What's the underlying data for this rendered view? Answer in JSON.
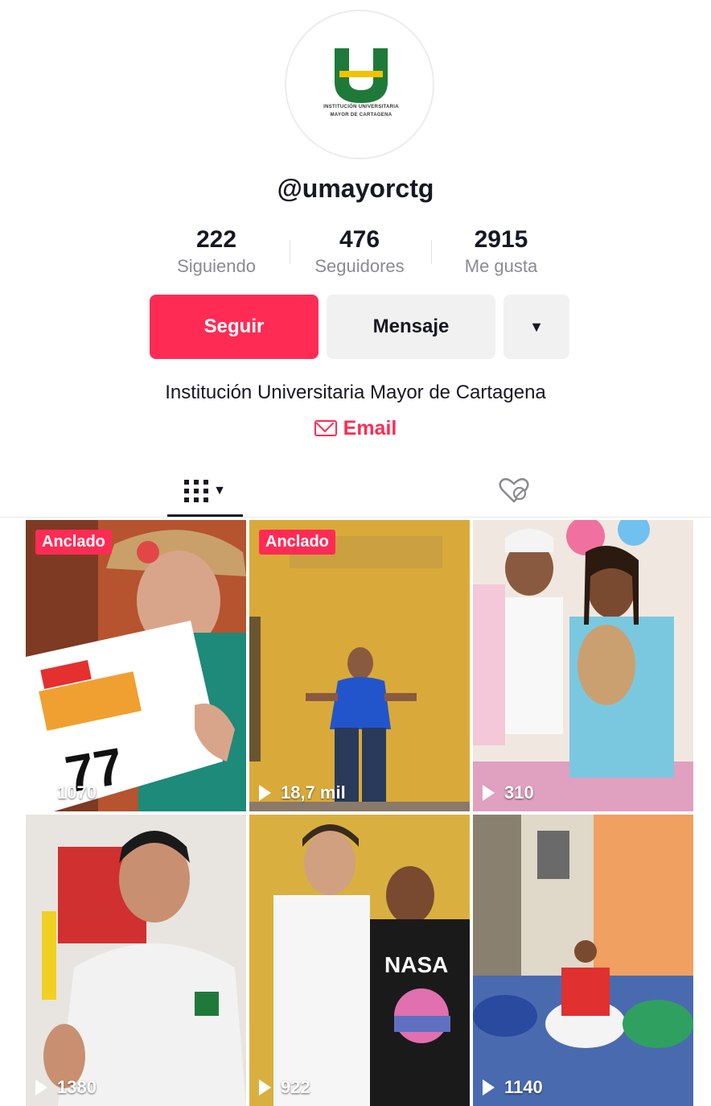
{
  "profile": {
    "logo_text_line1": "INSTITUCIÓN UNIVERSITARIA",
    "logo_text_line2": "MAYOR DE CARTAGENA",
    "handle": "@umayorctg",
    "bio": "Institución Universitaria Mayor de Cartagena",
    "email_label": "Email",
    "brand_color": "#fe2c55"
  },
  "stats": [
    {
      "value": "222",
      "label": "Siguiendo"
    },
    {
      "value": "476",
      "label": "Seguidores"
    },
    {
      "value": "2915",
      "label": "Me gusta"
    }
  ],
  "actions": {
    "follow_label": "Seguir",
    "message_label": "Mensaje",
    "more_icon": "▼"
  },
  "tabs": [
    {
      "name": "videos",
      "icon": "grid-icon",
      "active": true
    },
    {
      "name": "liked",
      "icon": "heart-hidden-icon",
      "active": false
    }
  ],
  "videos": [
    {
      "pinned": true,
      "pin_label": "Anclado",
      "views": "1070"
    },
    {
      "pinned": true,
      "pin_label": "Anclado",
      "views": "18,7 mil"
    },
    {
      "pinned": false,
      "pin_label": "",
      "views": "310"
    },
    {
      "pinned": false,
      "pin_label": "",
      "views": "1380"
    },
    {
      "pinned": false,
      "pin_label": "",
      "views": "922"
    },
    {
      "pinned": false,
      "pin_label": "",
      "views": "1140"
    }
  ]
}
